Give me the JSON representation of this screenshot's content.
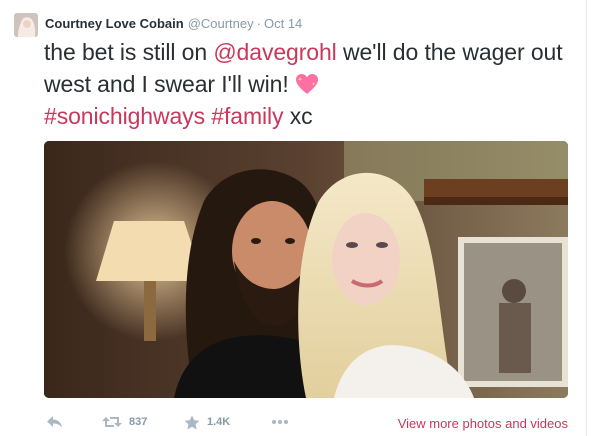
{
  "tweet": {
    "display_name": "Courtney Love Cobain",
    "handle": "@Courtney",
    "separator": "·",
    "timestamp": "Oct 14",
    "text_part1": "the bet is still on ",
    "mention": "@davegrohl",
    "text_part2": " we'll do the wager out west and I swear I'll win! ",
    "hashtag1": "#sonichighways",
    "space": " ",
    "hashtag2": "#family",
    "text_part3": " xc",
    "emoji": "sparkling-heart-icon"
  },
  "actions": {
    "retweet_count": "837",
    "favorite_count": "1.4K",
    "more_link": "View more photos and videos"
  },
  "colors": {
    "link": "#c8385a",
    "muted": "#8899a6",
    "text": "#292f33"
  }
}
